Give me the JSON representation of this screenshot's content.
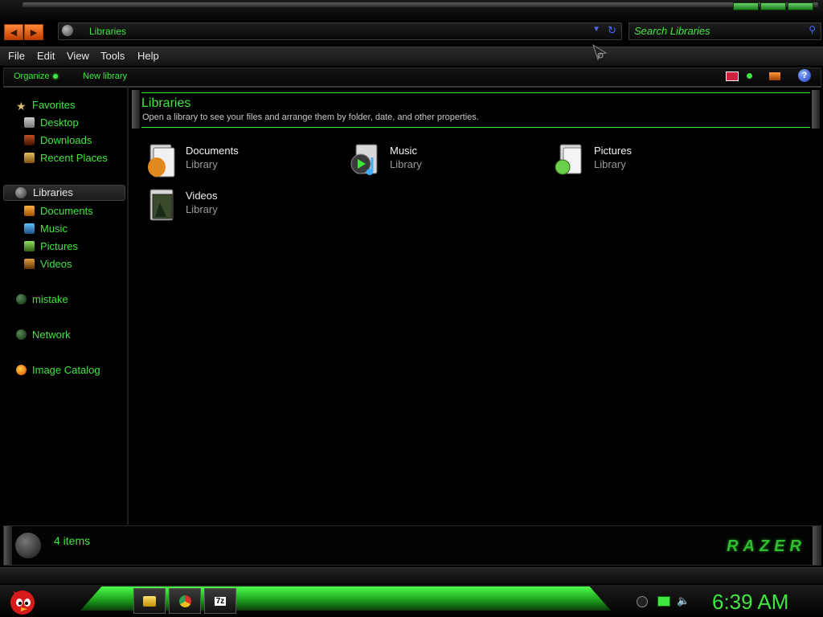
{
  "window": {
    "title": "Libraries"
  },
  "address": {
    "path": "Libraries"
  },
  "search": {
    "placeholder": "Search Libraries"
  },
  "menu": {
    "file": "File",
    "edit": "Edit",
    "view": "View",
    "tools": "Tools",
    "help": "Help"
  },
  "toolbar": {
    "organize": "Organize",
    "new_library": "New library"
  },
  "sidebar": {
    "favorites": {
      "label": "Favorites",
      "items": [
        "Desktop",
        "Downloads",
        "Recent Places"
      ]
    },
    "libraries": {
      "label": "Libraries",
      "items": [
        "Documents",
        "Music",
        "Pictures",
        "Videos"
      ]
    },
    "homegroup": "mistake",
    "network": "Network",
    "image_catalog": "Image Catalog"
  },
  "content": {
    "title": "Libraries",
    "subtitle": "Open a library to see your files and arrange them by folder, date, and other properties.",
    "items": [
      {
        "name": "Documents",
        "type": "Library"
      },
      {
        "name": "Music",
        "type": "Library"
      },
      {
        "name": "Pictures",
        "type": "Library"
      },
      {
        "name": "Videos",
        "type": "Library"
      }
    ]
  },
  "status": {
    "count": "4 items",
    "brand": "RAZER"
  },
  "taskbar": {
    "clock": "6:39 AM",
    "app3_label": "7z"
  },
  "colors": {
    "accent": "#3fe63f",
    "background": "#000000",
    "nav_orange": "#ff6a1a",
    "link_blue": "#4a6aff"
  }
}
